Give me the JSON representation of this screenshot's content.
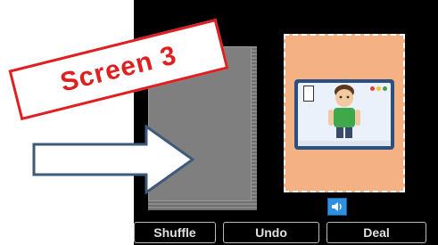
{
  "overlay_label": "Screen 3",
  "buttons": {
    "shuffle": "Shuffle",
    "undo": "Undo",
    "deal": "Deal"
  },
  "icons": {
    "sound": "speaker-icon"
  },
  "colors": {
    "card_slot": "#f4b183",
    "sound_button": "#2f8fe0",
    "label_red": "#e02020"
  }
}
